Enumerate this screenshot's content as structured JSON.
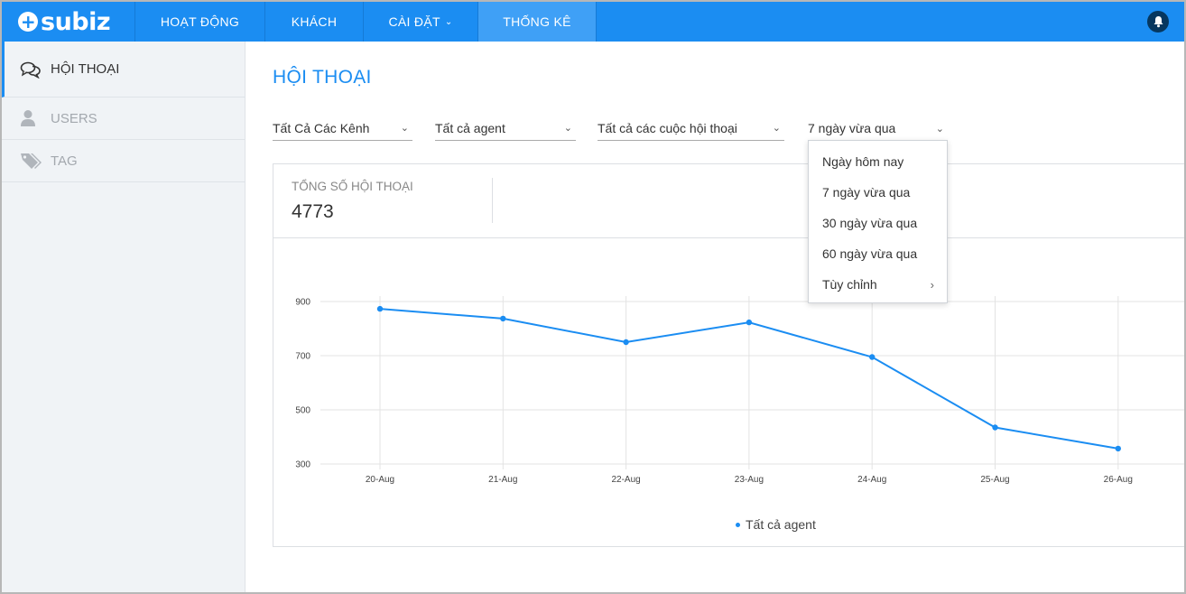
{
  "brand": {
    "logo_text": "subiz",
    "logo_mark": "+"
  },
  "nav": {
    "items": [
      {
        "label": "HOẠT ĐỘNG"
      },
      {
        "label": "KHÁCH"
      },
      {
        "label": "CÀI ĐẶT",
        "has_caret": true
      },
      {
        "label": "THỐNG KÊ",
        "active": true
      }
    ],
    "notification_icon": "bell-icon"
  },
  "sidebar": {
    "items": [
      {
        "label": "HỘI THOẠI",
        "icon": "chat-bubbles-icon",
        "active": true
      },
      {
        "label": "USERS",
        "icon": "user-icon"
      },
      {
        "label": "TAG",
        "icon": "tag-icon"
      }
    ]
  },
  "main": {
    "title": "HỘI THOẠI",
    "filters": {
      "channel": "Tất Cả Các Kênh",
      "agent": "Tất cả agent",
      "conversations": "Tất cả các cuộc hội thoại",
      "period": "7 ngày vừa qua"
    },
    "period_options": [
      "Ngày hôm nay",
      "7 ngày vừa qua",
      "30 ngày vừa qua",
      "60 ngày vừa qua",
      "Tùy chỉnh"
    ],
    "stat": {
      "label": "TỔNG SỐ HỘI THOẠI",
      "value": "4773"
    }
  },
  "colors": {
    "accent": "#1b8df2",
    "nav_active": "#3fa0f6",
    "sidebar_bg": "#f0f3f6"
  },
  "chart_data": {
    "type": "line",
    "categories": [
      "20-Aug",
      "21-Aug",
      "22-Aug",
      "23-Aug",
      "24-Aug",
      "25-Aug",
      "26-Aug"
    ],
    "series": [
      {
        "name": "Tất cả agent",
        "values": [
          873,
          837,
          750,
          823,
          695,
          435,
          357
        ],
        "color": "#1b8df2"
      }
    ],
    "ylim": [
      300,
      900
    ],
    "yticks": [
      300,
      500,
      700,
      900
    ],
    "grid": true,
    "legend": "bottom-center"
  }
}
